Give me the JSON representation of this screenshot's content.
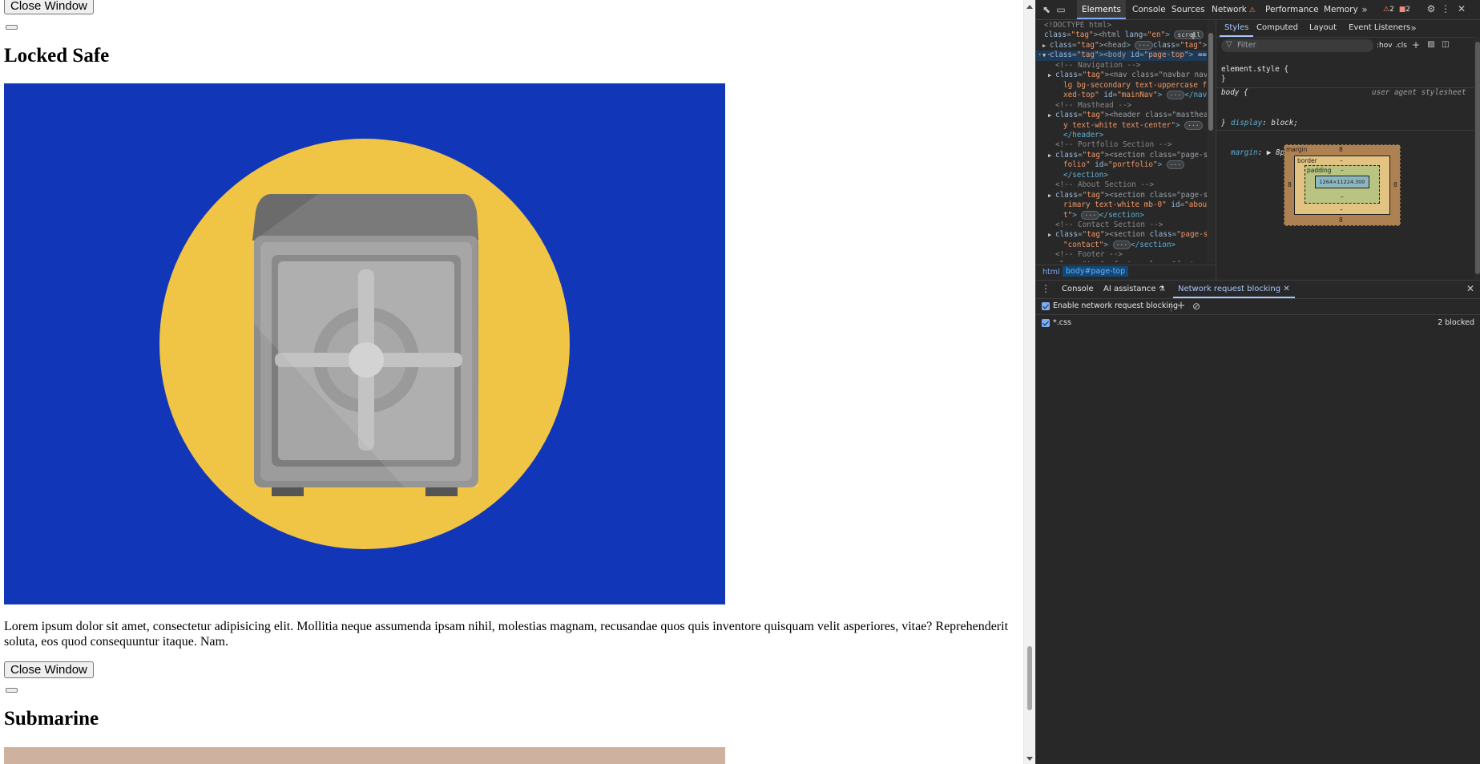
{
  "page": {
    "close_window_label": "Close Window",
    "sections": [
      {
        "title": "Locked Safe",
        "paragraph": "Lorem ipsum dolor sit amet, consectetur adipisicing elit. Mollitia neque assumenda ipsam nihil, molestias magnam, recusandae quos quis inventore quisquam velit asperiores, vitae? Reprehenderit soluta, eos quod consequuntur itaque. Nam.",
        "image_bg": "#1236b8",
        "image_circle": "#f0c445"
      },
      {
        "title": "Submarine",
        "image_bg": "#cfb19f"
      }
    ]
  },
  "devtools": {
    "tabs": [
      "Elements",
      "Console",
      "Sources",
      "Network",
      "Performance",
      "Memory"
    ],
    "active_tab": "Elements",
    "warnings_count": "2",
    "errors_count": "2",
    "dom_lines": [
      {
        "indent": 0,
        "kind": "comment",
        "text": "<!DOCTYPE html>"
      },
      {
        "indent": 0,
        "kind": "open",
        "text": "<html lang=\"en\">",
        "badge": "scroll"
      },
      {
        "indent": 1,
        "kind": "collapsed",
        "text": "<head>",
        "tail": "</head>"
      },
      {
        "indent": 1,
        "kind": "selected",
        "text": "<body id=\"page-top\">",
        "tail": "== $0"
      },
      {
        "indent": 2,
        "kind": "comment",
        "text": "<!-- Navigation -->"
      },
      {
        "indent": 2,
        "kind": "collapsed",
        "text": "<nav class=\"navbar navbar-expand-lg bg-secondary text-uppercase fixed-top\" id=\"mainNav\">",
        "tail": "</nav>"
      },
      {
        "indent": 2,
        "kind": "comment",
        "text": "<!-- Masthead -->"
      },
      {
        "indent": 2,
        "kind": "collapsed",
        "text": "<header class=\"masthead bg-primary text-white text-center\">",
        "tail": "</header>"
      },
      {
        "indent": 2,
        "kind": "comment",
        "text": "<!-- Portfolio Section -->"
      },
      {
        "indent": 2,
        "kind": "collapsed",
        "text": "<section class=\"page-section portfolio\" id=\"portfolio\">",
        "tail": "</section>"
      },
      {
        "indent": 2,
        "kind": "comment",
        "text": "<!-- About Section -->"
      },
      {
        "indent": 2,
        "kind": "collapsed",
        "text": "<section class=\"page-section bg-primary text-white mb-0\" id=\"about\">",
        "tail": "</section>"
      },
      {
        "indent": 2,
        "kind": "comment",
        "text": "<!-- Contact Section -->"
      },
      {
        "indent": 2,
        "kind": "collapsed",
        "text": "<section class=\"page-section\" id=\"contact\">",
        "tail": "</section>"
      },
      {
        "indent": 2,
        "kind": "comment",
        "text": "<!-- Footer -->"
      },
      {
        "indent": 2,
        "kind": "collapsed",
        "text": "<footer class=\"footer text-cente"
      }
    ],
    "breadcrumb": [
      "html",
      "body#page-top"
    ],
    "styles_tabs": [
      "Styles",
      "Computed",
      "Layout",
      "Event Listeners"
    ],
    "filter_placeholder": "Filter",
    "hov_label": ":hov",
    "cls_label": ".cls",
    "element_style": "element.style {",
    "close_brace": "}",
    "body_selector": "body {",
    "ua_label": "user agent stylesheet",
    "rules": [
      {
        "prop": "display",
        "value": "block;"
      },
      {
        "prop": "margin",
        "value": "▶ 8px;"
      }
    ],
    "box_model": {
      "margin_label": "margin",
      "margin_value": "8",
      "border_label": "border",
      "padding_label": "padding",
      "dash": "–",
      "content_size": "1264×11224.300"
    },
    "drawer_tabs": [
      "Console",
      "AI assistance",
      "Network request blocking"
    ],
    "active_drawer_tab": "Network request blocking",
    "enable_blocking_label": "Enable network request blocking",
    "patterns": [
      {
        "pattern": "*.css",
        "status": "2 blocked"
      }
    ]
  }
}
